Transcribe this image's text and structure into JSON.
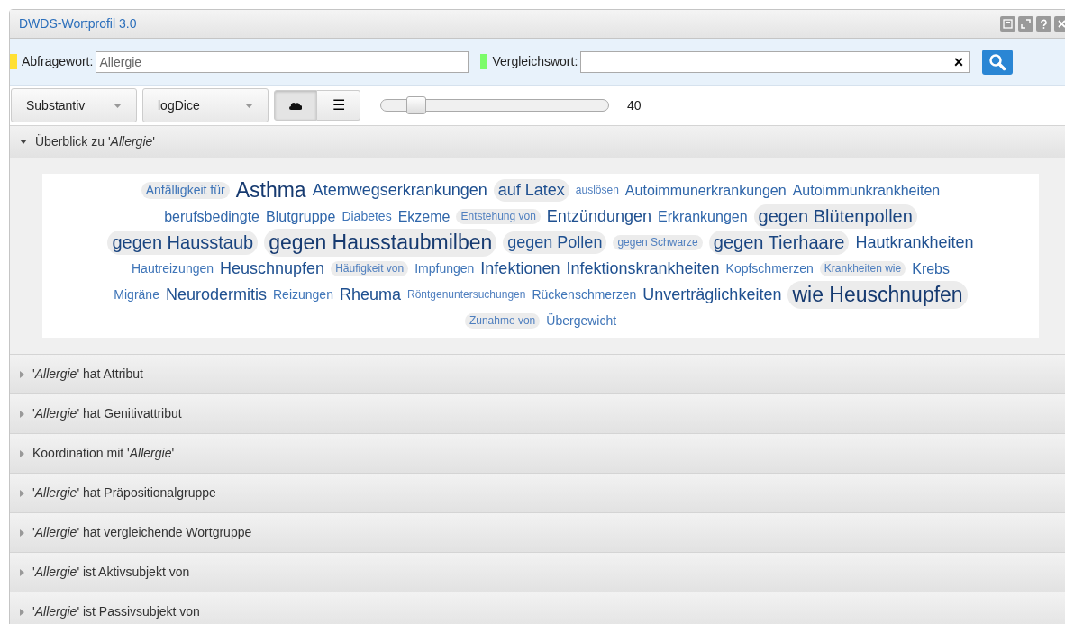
{
  "window": {
    "title": "DWDS-Wortprofil 3.0"
  },
  "query": {
    "label": "Abfragewort:",
    "value": "Allergie",
    "color": "#ffe033"
  },
  "compare": {
    "label": "Vergleichswort:",
    "clear": "×",
    "color": "#7cfc6a"
  },
  "toolbar": {
    "pos": "Substantiv",
    "measure": "logDice",
    "views": [
      {
        "kind": "cloud",
        "selected": true
      },
      {
        "kind": "list",
        "selected": false,
        "glyph": "☰"
      }
    ],
    "slider": {
      "level": 0.12
    },
    "count": "40"
  },
  "overview": {
    "title": "Überblick zu '*Allergie*'",
    "expanded": true,
    "lines": [
      {
        "words": [
          {
            "text": "Anfälligkeit für",
            "kind": "small",
            "boxed": true
          },
          {
            "text": "Asthma",
            "kind": "giant",
            "boxed": false
          },
          {
            "text": "Atemwegserkrankungen",
            "kind": "large",
            "boxed": false
          },
          {
            "text": "auf Latex",
            "kind": "large",
            "boxed": true
          },
          {
            "text": "auslösen",
            "kind": "tiny",
            "boxed": false
          },
          {
            "text": "Autoimmunerkrankungen",
            "kind": "medium",
            "boxed": false
          },
          {
            "text": "Autoimmunkrankheiten",
            "kind": "medium",
            "boxed": false
          }
        ]
      },
      {
        "words": [
          {
            "text": "berufsbedingte",
            "kind": "medium",
            "boxed": false
          },
          {
            "text": "Blutgruppe",
            "kind": "medium",
            "boxed": false
          },
          {
            "text": "Diabetes",
            "kind": "small",
            "boxed": false
          },
          {
            "text": "Ekzeme",
            "kind": "medium",
            "boxed": false
          },
          {
            "text": "Entstehung von",
            "kind": "tiny",
            "boxed": true
          },
          {
            "text": "Entzündungen",
            "kind": "large",
            "boxed": false
          },
          {
            "text": "Erkrankungen",
            "kind": "medium",
            "boxed": false
          },
          {
            "text": "gegen Blütenpollen",
            "kind": "huge",
            "boxed": true
          }
        ]
      },
      {
        "words": [
          {
            "text": "gegen Hausstaub",
            "kind": "huge",
            "boxed": true
          },
          {
            "text": "gegen Hausstaubmilben",
            "kind": "giant",
            "boxed": true
          },
          {
            "text": "gegen Pollen",
            "kind": "large",
            "boxed": true
          },
          {
            "text": "gegen Schwarze",
            "kind": "tiny",
            "boxed": true
          },
          {
            "text": "gegen Tierhaare",
            "kind": "huge",
            "boxed": true
          },
          {
            "text": "Hautkrankheiten",
            "kind": "large",
            "boxed": false
          }
        ]
      },
      {
        "words": [
          {
            "text": "Hautreizungen",
            "kind": "small",
            "boxed": false
          },
          {
            "text": "Heuschnupfen",
            "kind": "large",
            "boxed": false
          },
          {
            "text": "Häufigkeit von",
            "kind": "tiny",
            "boxed": true
          },
          {
            "text": "Impfungen",
            "kind": "small",
            "boxed": false
          },
          {
            "text": "Infektionen",
            "kind": "large",
            "boxed": false
          },
          {
            "text": "Infektionskrankheiten",
            "kind": "large",
            "boxed": false
          },
          {
            "text": "Kopfschmerzen",
            "kind": "small",
            "boxed": false
          },
          {
            "text": "Krankheiten wie",
            "kind": "tiny",
            "boxed": true
          },
          {
            "text": "Krebs",
            "kind": "medium",
            "boxed": false
          }
        ]
      },
      {
        "words": [
          {
            "text": "Migräne",
            "kind": "small",
            "boxed": false
          },
          {
            "text": "Neurodermitis",
            "kind": "large",
            "boxed": false
          },
          {
            "text": "Reizungen",
            "kind": "small",
            "boxed": false
          },
          {
            "text": "Rheuma",
            "kind": "large",
            "boxed": false
          },
          {
            "text": "Röntgenuntersuchungen",
            "kind": "tiny",
            "boxed": false
          },
          {
            "text": "Rückenschmerzen",
            "kind": "small",
            "boxed": false
          },
          {
            "text": "Unverträglichkeiten",
            "kind": "large",
            "boxed": false
          },
          {
            "text": "wie Heuschnupfen",
            "kind": "giant",
            "boxed": true
          }
        ]
      },
      {
        "words": [
          {
            "text": "Zunahme von",
            "kind": "tiny",
            "boxed": true
          },
          {
            "text": "Übergewicht",
            "kind": "small",
            "boxed": false
          }
        ]
      }
    ]
  },
  "sections": [
    {
      "title": "'*Allergie*' hat Attribut",
      "expanded": false
    },
    {
      "title": "'*Allergie*' hat Genitivattribut",
      "expanded": false
    },
    {
      "title": "Koordination mit '*Allergie*'",
      "expanded": false
    },
    {
      "title": "'*Allergie*' hat Präpositionalgruppe",
      "expanded": false
    },
    {
      "title": "'*Allergie*' hat vergleichende Wortgruppe",
      "expanded": false
    },
    {
      "title": "'*Allergie*' ist Aktivsubjekt von",
      "expanded": false
    },
    {
      "title": "'*Allergie*' ist Passivsubjekt von",
      "expanded": false
    }
  ]
}
